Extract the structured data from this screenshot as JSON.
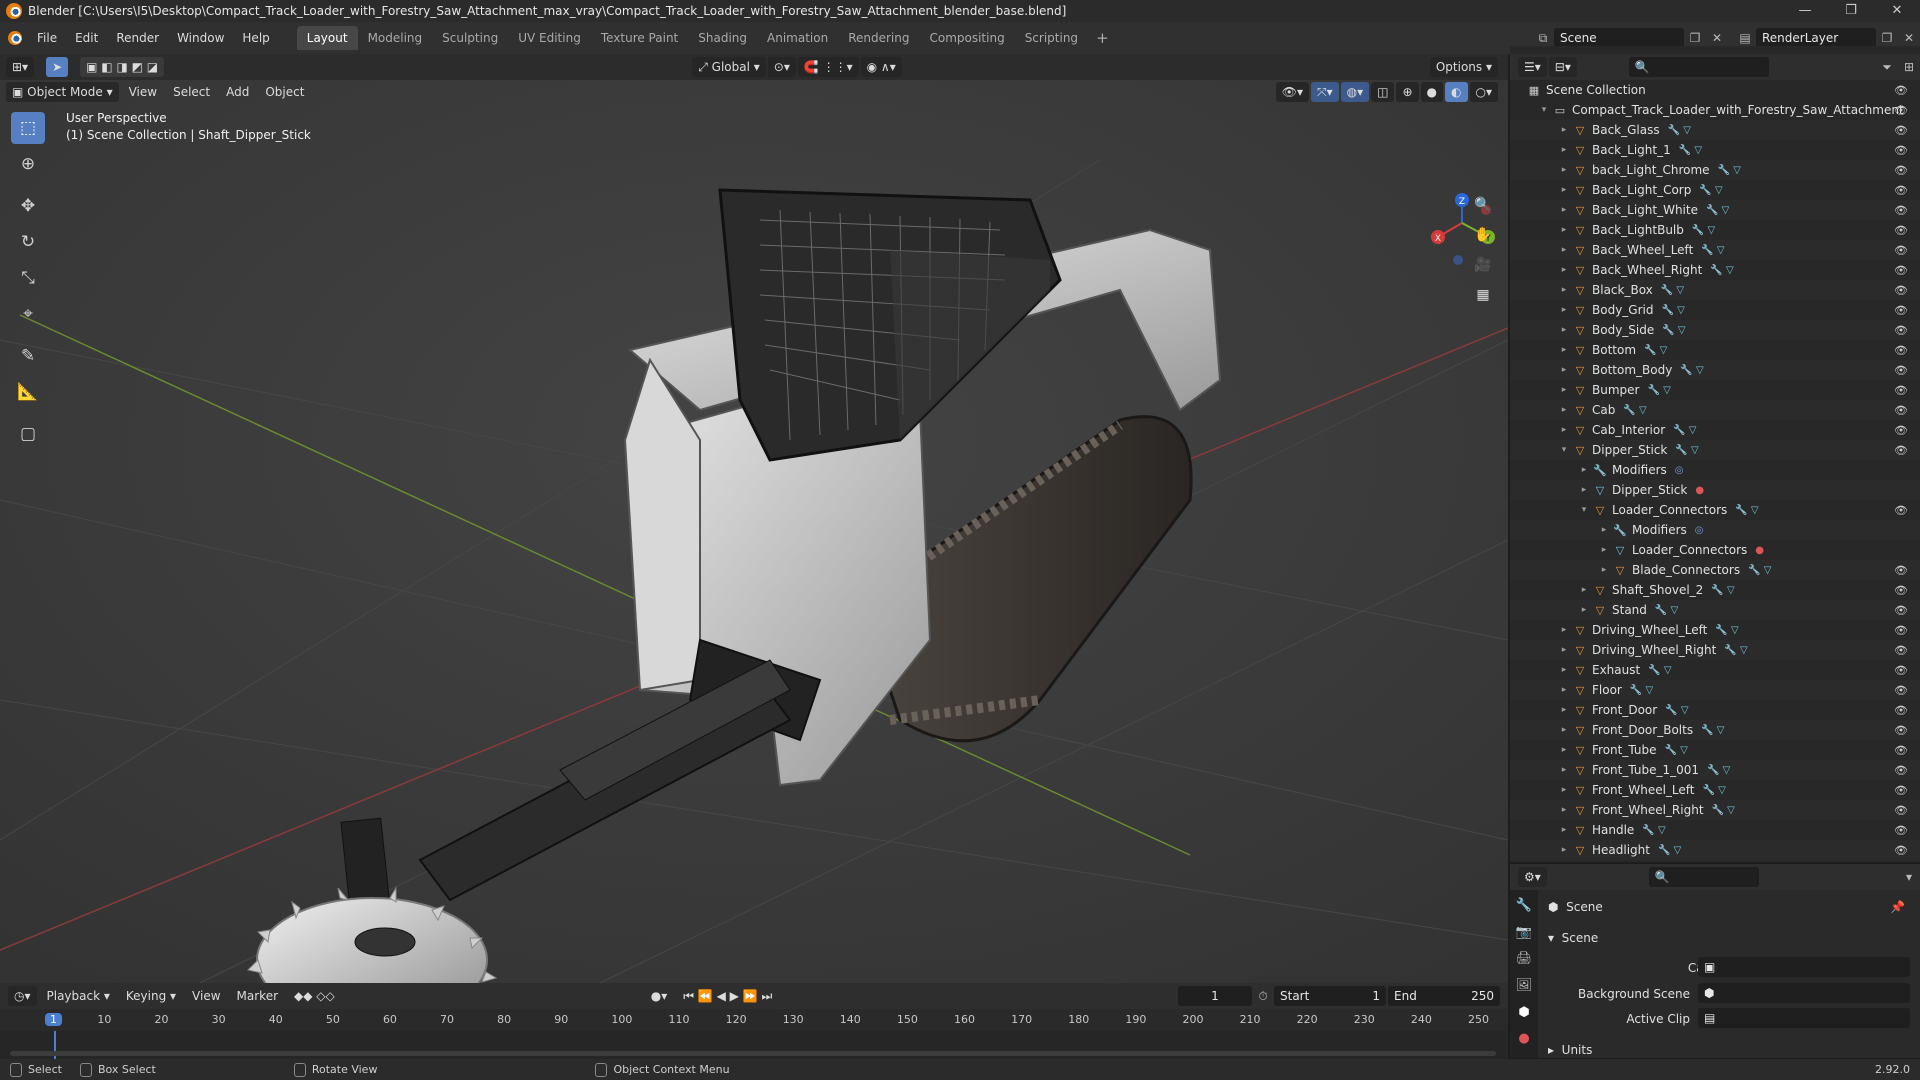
{
  "window": {
    "title": "Blender [C:\\Users\\I5\\Desktop\\Compact_Track_Loader_with_Forestry_Saw_Attachment_max_vray\\Compact_Track_Loader_with_Forestry_Saw_Attachment_blender_base.blend]"
  },
  "menu": [
    "File",
    "Edit",
    "Render",
    "Window",
    "Help"
  ],
  "workspaces": [
    "Layout",
    "Modeling",
    "Sculpting",
    "UV Editing",
    "Texture Paint",
    "Shading",
    "Animation",
    "Rendering",
    "Compositing",
    "Scripting"
  ],
  "active_workspace": "Layout",
  "scene_field": "Scene",
  "renderlayer_field": "RenderLayer",
  "viewport": {
    "mode": "Object Mode",
    "menus": [
      "View",
      "Select",
      "Add",
      "Object"
    ],
    "transform_orientation": "Global",
    "options_label": "Options",
    "info_line1": "User Perspective",
    "info_line2": "(1) Scene Collection | Shaft_Dipper_Stick"
  },
  "gizmo": {
    "x": "X",
    "y": "Y",
    "z": "Z"
  },
  "outliner": {
    "root": "Scene Collection",
    "items": [
      {
        "label": "Compact_Track_Loader_with_Forestry_Saw_Attachment",
        "type": "coll",
        "depth": 0,
        "open": true
      },
      {
        "label": "Back_Glass",
        "type": "obj",
        "depth": 1
      },
      {
        "label": "Back_Light_1",
        "type": "obj",
        "depth": 1
      },
      {
        "label": "back_Light_Chrome",
        "type": "obj",
        "depth": 1
      },
      {
        "label": "Back_Light_Corp",
        "type": "obj",
        "depth": 1
      },
      {
        "label": "Back_Light_White",
        "type": "obj",
        "depth": 1
      },
      {
        "label": "Back_LightBulb",
        "type": "obj",
        "depth": 1
      },
      {
        "label": "Back_Wheel_Left",
        "type": "obj",
        "depth": 1
      },
      {
        "label": "Back_Wheel_Right",
        "type": "obj",
        "depth": 1
      },
      {
        "label": "Black_Box",
        "type": "obj",
        "depth": 1
      },
      {
        "label": "Body_Grid",
        "type": "obj",
        "depth": 1
      },
      {
        "label": "Body_Side",
        "type": "obj",
        "depth": 1
      },
      {
        "label": "Bottom",
        "type": "obj",
        "depth": 1
      },
      {
        "label": "Bottom_Body",
        "type": "obj",
        "depth": 1
      },
      {
        "label": "Bumper",
        "type": "obj",
        "depth": 1
      },
      {
        "label": "Cab",
        "type": "obj",
        "depth": 1
      },
      {
        "label": "Cab_Interior",
        "type": "obj",
        "depth": 1
      },
      {
        "label": "Dipper_Stick",
        "type": "obj",
        "depth": 1,
        "open": true
      },
      {
        "label": "Modifiers",
        "type": "mod",
        "depth": 2
      },
      {
        "label": "Dipper_Stick",
        "type": "mesh",
        "depth": 2
      },
      {
        "label": "Loader_Connectors",
        "type": "obj",
        "depth": 2,
        "open": true
      },
      {
        "label": "Modifiers",
        "type": "mod",
        "depth": 3
      },
      {
        "label": "Loader_Connectors",
        "type": "mesh",
        "depth": 3
      },
      {
        "label": "Blade_Connectors",
        "type": "obj",
        "depth": 3
      },
      {
        "label": "Shaft_Shovel_2",
        "type": "obj",
        "depth": 2
      },
      {
        "label": "Stand",
        "type": "obj",
        "depth": 2
      },
      {
        "label": "Driving_Wheel_Left",
        "type": "obj",
        "depth": 1
      },
      {
        "label": "Driving_Wheel_Right",
        "type": "obj",
        "depth": 1
      },
      {
        "label": "Exhaust",
        "type": "obj",
        "depth": 1
      },
      {
        "label": "Floor",
        "type": "obj",
        "depth": 1
      },
      {
        "label": "Front_Door",
        "type": "obj",
        "depth": 1
      },
      {
        "label": "Front_Door_Bolts",
        "type": "obj",
        "depth": 1
      },
      {
        "label": "Front_Tube",
        "type": "obj",
        "depth": 1
      },
      {
        "label": "Front_Tube_1_001",
        "type": "obj",
        "depth": 1
      },
      {
        "label": "Front_Wheel_Left",
        "type": "obj",
        "depth": 1
      },
      {
        "label": "Front_Wheel_Right",
        "type": "obj",
        "depth": 1
      },
      {
        "label": "Handle",
        "type": "obj",
        "depth": 1
      },
      {
        "label": "Headlight",
        "type": "obj",
        "depth": 1
      }
    ]
  },
  "properties": {
    "context": "Scene",
    "panel": "Scene",
    "camera_label": "Camera",
    "background_scene_label": "Background Scene",
    "active_clip_label": "Active Clip",
    "units_label": "Units",
    "version": "2.92.0"
  },
  "timeline": {
    "menus": [
      "Playback",
      "Keying",
      "View",
      "Marker"
    ],
    "current_frame": "1",
    "start_label": "Start",
    "start_value": "1",
    "end_label": "End",
    "end_value": "250",
    "ticks": [
      "1",
      "10",
      "20",
      "30",
      "40",
      "50",
      "60",
      "70",
      "80",
      "90",
      "100",
      "110",
      "120",
      "130",
      "140",
      "150",
      "160",
      "170",
      "180",
      "190",
      "200",
      "210",
      "220",
      "230",
      "240",
      "250"
    ]
  },
  "status": {
    "select": "Select",
    "box_select": "Box Select",
    "rotate_view": "Rotate View",
    "context_menu": "Object Context Menu"
  }
}
